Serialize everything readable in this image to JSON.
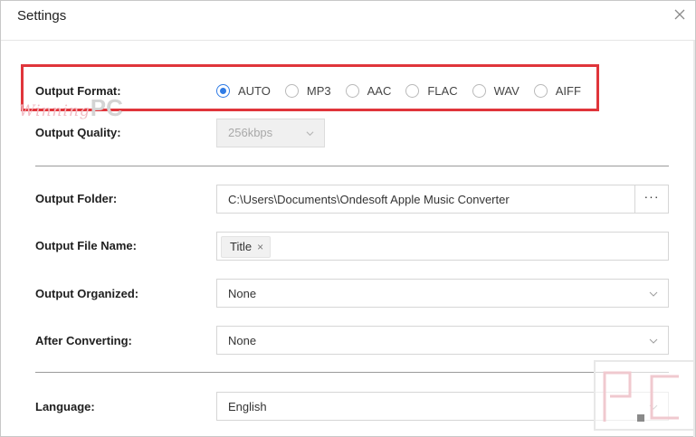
{
  "window": {
    "title": "Settings"
  },
  "output_format": {
    "label": "Output Format:",
    "options": [
      {
        "label": "AUTO",
        "selected": true
      },
      {
        "label": "MP3",
        "selected": false
      },
      {
        "label": "AAC",
        "selected": false
      },
      {
        "label": "FLAC",
        "selected": false
      },
      {
        "label": "WAV",
        "selected": false
      },
      {
        "label": "AIFF",
        "selected": false
      }
    ]
  },
  "watermark": {
    "script": "Winning",
    "pc": "PC"
  },
  "output_quality": {
    "label": "Output Quality:",
    "value": "256kbps",
    "disabled": true
  },
  "output_folder": {
    "label": "Output Folder:",
    "value": "C:\\Users\\Documents\\Ondesoft Apple Music Converter",
    "browse_label": "···"
  },
  "output_file_name": {
    "label": "Output File Name:",
    "tags": [
      {
        "label": "Title",
        "remove": "×"
      }
    ]
  },
  "output_organized": {
    "label": "Output Organized:",
    "value": "None"
  },
  "after_converting": {
    "label": "After Converting:",
    "value": "None"
  },
  "language": {
    "label": "Language:",
    "value": "English"
  },
  "colors": {
    "accent": "#2f7be5",
    "highlight": "#e0353b",
    "disabled_bg": "#f0f0f0"
  },
  "icons": {
    "close": "close-icon",
    "dropdown": "chevron-down-icon"
  }
}
